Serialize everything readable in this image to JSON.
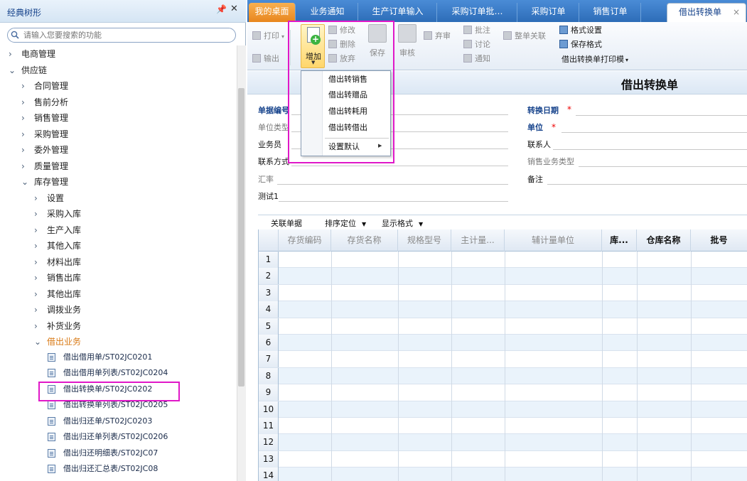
{
  "sidebar": {
    "title": "经典树形",
    "pin_icon": "pin-icon",
    "close_icon": "close-icon",
    "search_placeholder": "请输入您要搜索的功能",
    "tree": [
      {
        "label": "电商管理",
        "state": "collapsed"
      },
      {
        "label": "供应链",
        "state": "expanded"
      },
      {
        "label": "合同管理",
        "state": "collapsed"
      },
      {
        "label": "售前分析",
        "state": "collapsed"
      },
      {
        "label": "销售管理",
        "state": "collapsed"
      },
      {
        "label": "采购管理",
        "state": "collapsed"
      },
      {
        "label": "委外管理",
        "state": "collapsed"
      },
      {
        "label": "质量管理",
        "state": "collapsed"
      },
      {
        "label": "库存管理",
        "state": "expanded"
      },
      {
        "label": "设置",
        "state": "collapsed"
      },
      {
        "label": "采购入库",
        "state": "collapsed"
      },
      {
        "label": "生产入库",
        "state": "collapsed"
      },
      {
        "label": "其他入库",
        "state": "collapsed"
      },
      {
        "label": "材料出库",
        "state": "collapsed"
      },
      {
        "label": "销售出库",
        "state": "collapsed"
      },
      {
        "label": "其他出库",
        "state": "collapsed"
      },
      {
        "label": "调拨业务",
        "state": "collapsed"
      },
      {
        "label": "补货业务",
        "state": "collapsed"
      },
      {
        "label": "借出业务",
        "state": "expanded"
      },
      {
        "label": "借出借用单/ST02JC0201",
        "state": "leaf"
      },
      {
        "label": "借出借用单列表/ST02JC0204",
        "state": "leaf"
      },
      {
        "label": "借出转换单/ST02JC0202",
        "state": "leaf",
        "selected": true
      },
      {
        "label": "借出转换单列表/ST02JC0205",
        "state": "leaf"
      },
      {
        "label": "借出归还单/ST02JC0203",
        "state": "leaf"
      },
      {
        "label": "借出归还单列表/ST02JC0206",
        "state": "leaf"
      },
      {
        "label": "借出归还明细表/ST02JC07",
        "state": "leaf"
      },
      {
        "label": "借出归还汇总表/ST02JC08",
        "state": "leaf"
      }
    ]
  },
  "tabs": [
    {
      "label": "我的桌面"
    },
    {
      "label": "业务通知"
    },
    {
      "label": "生产订单输入"
    },
    {
      "label": "采购订单批…"
    },
    {
      "label": "采购订单"
    },
    {
      "label": "销售订单"
    },
    {
      "label": "借出转换单",
      "close": "×"
    }
  ],
  "toolbar": {
    "print": "打印",
    "export": "输出",
    "add": "增加",
    "modify": "修改",
    "delete": "删除",
    "abandon": "放弃",
    "save": "保存",
    "audit": "审核",
    "unaudit": "弃审",
    "approve": "批注",
    "discuss": "讨论",
    "notify": "通知",
    "whole_link": "整单关联",
    "format_settings": "格式设置",
    "save_format": "保存格式",
    "print_template": "借出转换单打印模"
  },
  "add_menu": {
    "items": [
      "借出转销售",
      "借出转赠品",
      "借出转耗用",
      "借出转借出"
    ],
    "default_setting": "设置默认"
  },
  "form": {
    "title": "借出转换单",
    "fields": {
      "doc_no": "单据编号",
      "unit_type": "单位类型",
      "salesman": "业务员",
      "contact_info": "联系方式",
      "exchange_rate": "汇率",
      "test1": "测试1",
      "convert_date": "转换日期",
      "unit": "单位",
      "contact": "联系人",
      "sales_type": "销售业务类型",
      "remark": "备注"
    },
    "required_mark": "*"
  },
  "grid": {
    "toolbar": [
      "关联单据",
      "排序定位",
      "显示格式"
    ],
    "columns": [
      "存货编码",
      "存货名称",
      "规格型号",
      "主计量...",
      "辅计量单位",
      "库...",
      "仓库名称",
      "批号"
    ],
    "rows": [
      "1",
      "2",
      "3",
      "4",
      "5",
      "6",
      "7",
      "8",
      "9",
      "10",
      "11",
      "12",
      "13",
      "14"
    ]
  },
  "colors": {
    "accent": "#e018c8",
    "tabbar": "#2d6db8",
    "home_tab": "#e8861e",
    "link": "#15428b"
  }
}
